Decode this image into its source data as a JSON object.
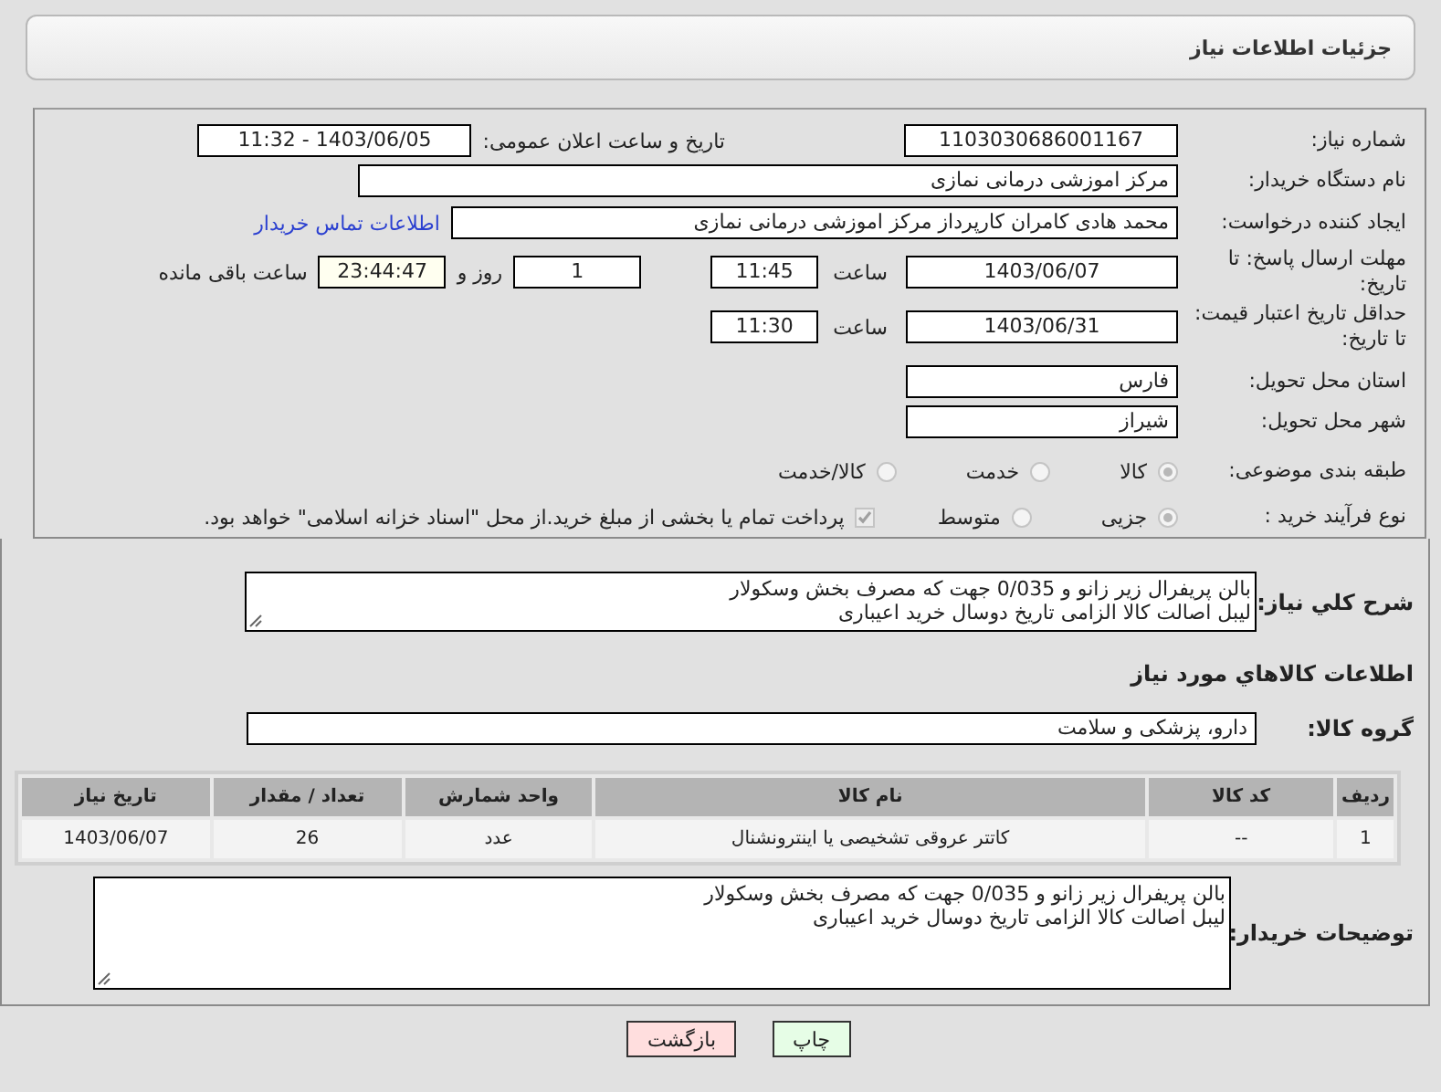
{
  "page_title": "جزئیات اطلاعات نیاز",
  "need_number": {
    "label": "شماره نیاز:",
    "value": "1103030686001167"
  },
  "announce": {
    "label": "تاریخ و ساعت اعلان عمومی:",
    "value": "1403/06/05 - 11:32"
  },
  "buyer_org": {
    "label": "نام دستگاه خریدار:",
    "value": "مرکز اموزشی درمانی نمازی"
  },
  "requester": {
    "label": "ایجاد کننده درخواست:",
    "value": "محمد هادی کامران کارپرداز مرکز اموزشی درمانی نمازی",
    "link": "اطلاعات تماس خریدار"
  },
  "reply_deadline": {
    "label": "مهلت ارسال پاسخ: تا تاریخ:",
    "date": "1403/06/07",
    "time_label": "ساعت",
    "time": "11:45",
    "days": "1",
    "days_label": "روز و",
    "remaining": "23:44:47",
    "remaining_label": "ساعت باقی مانده"
  },
  "price_validity": {
    "label": "حداقل تاریخ اعتبار قیمت: تا تاریخ:",
    "date": "1403/06/31",
    "time_label": "ساعت",
    "time": "11:30"
  },
  "province": {
    "label": "استان محل تحویل:",
    "value": "فارس"
  },
  "city": {
    "label": "شهر محل تحویل:",
    "value": "شیراز"
  },
  "category": {
    "label": "طبقه بندی موضوعی:",
    "options": [
      {
        "label": "کالا",
        "selected": true
      },
      {
        "label": "خدمت",
        "selected": false
      },
      {
        "label": "کالا/خدمت",
        "selected": false
      }
    ]
  },
  "purchase_type": {
    "label": "نوع فرآیند خرید :",
    "options": [
      {
        "label": "جزیی",
        "selected": true
      },
      {
        "label": "متوسط",
        "selected": false
      }
    ],
    "payment_note": {
      "label": "پرداخت تمام یا بخشی از مبلغ خرید.از محل \"اسناد خزانه اسلامی\" خواهد بود.",
      "checked": true
    }
  },
  "description": {
    "label": "شرح کلي نیاز:",
    "lines": [
      "بالن پریفرال زیر زانو و 0/035 جهت که مصرف بخش وسکولار",
      "لیبل اصالت کالا الزامی تاریخ دوسال  خرید اعیباری"
    ]
  },
  "goods_heading": "اطلاعات کالاهاي مورد نیاز",
  "goods_group": {
    "label": "گروه کالا:",
    "value": "دارو، پزشکی و سلامت"
  },
  "table": {
    "columns": [
      "ردیف",
      "کد کالا",
      "نام کالا",
      "واحد شمارش",
      "تعداد / مقدار",
      "تاریخ نیاز"
    ],
    "rows": [
      [
        "1",
        "--",
        "کاتتر عروقی تشخیصی یا اینترونشنال",
        "عدد",
        "26",
        "1403/06/07"
      ]
    ]
  },
  "buyer_notes": {
    "label": "توضیحات خریدار:",
    "lines": [
      "بالن پریفرال زیر زانو و 0/035 جهت که مصرف بخش وسکولار",
      "لیبل اصالت کالا الزامی تاریخ دوسال  خرید اعیباری"
    ]
  },
  "buttons": [
    {
      "label": "چاپ",
      "kind": "print"
    },
    {
      "label": "بازگشت",
      "kind": "back"
    }
  ]
}
